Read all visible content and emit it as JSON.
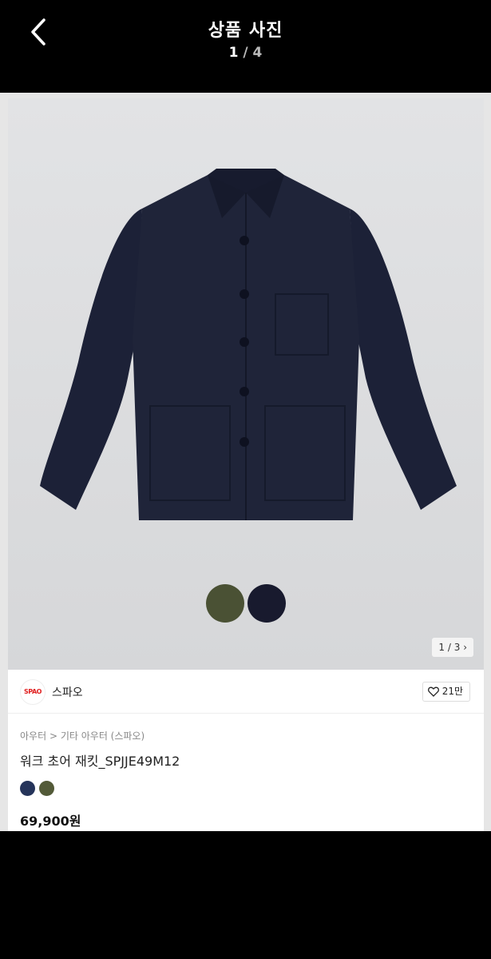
{
  "header": {
    "title": "상품 사진",
    "counter_current": "1",
    "counter_sep": "/",
    "counter_total": "4"
  },
  "photo": {
    "pager": "1 / 3",
    "jacket_color": "#1d2238",
    "swatch_colors": [
      "#4a5134",
      "#181a2e"
    ]
  },
  "brand": {
    "logo_text": "SPAO",
    "name": "스파오",
    "likes": "21만"
  },
  "product": {
    "breadcrumb_1": "아우터",
    "breadcrumb_sep": ">",
    "breadcrumb_2": "기타 아우터 (스파오)",
    "name": "워크 초어 재킷_SPJJE49M12",
    "color_swatches": [
      "#25345a",
      "#535a38"
    ],
    "price": "69,900원"
  },
  "colors": {
    "topbar": "#000000",
    "background": "#e6e6e6",
    "brand_red": "#e02020"
  }
}
